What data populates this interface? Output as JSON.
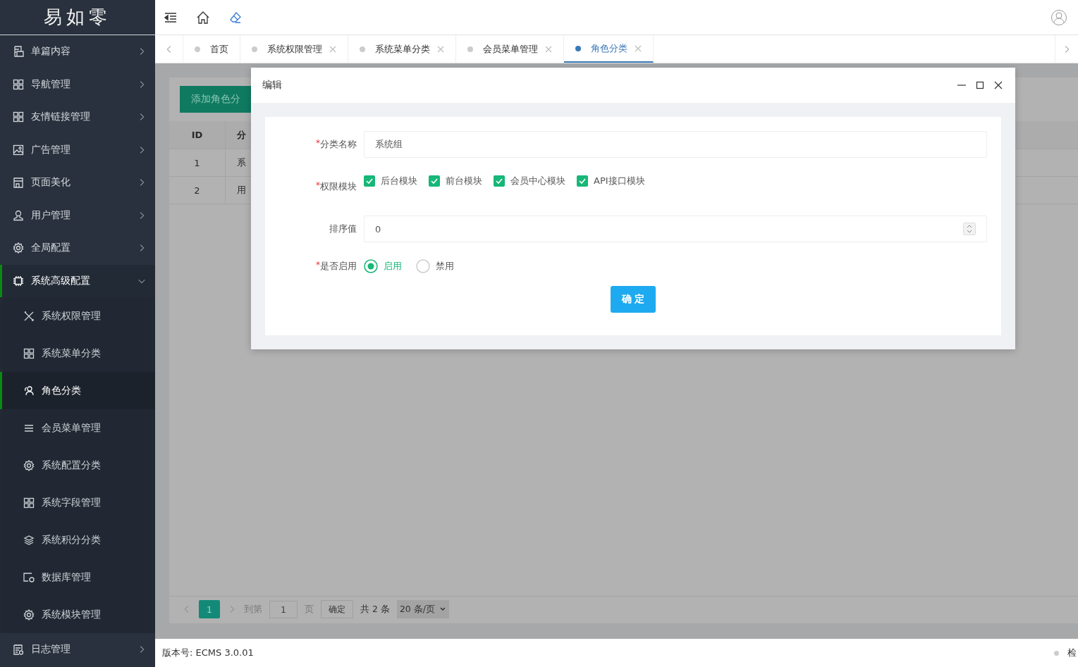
{
  "logo": {
    "text": "易如零"
  },
  "sidebar": {
    "items": [
      {
        "label": "单篇内容",
        "expanded": false,
        "selected": false
      },
      {
        "label": "导航管理",
        "expanded": false,
        "selected": false
      },
      {
        "label": "友情链接管理",
        "expanded": false,
        "selected": false
      },
      {
        "label": "广告管理",
        "expanded": false,
        "selected": false
      },
      {
        "label": "页面美化",
        "expanded": false,
        "selected": false
      },
      {
        "label": "用户管理",
        "expanded": false,
        "selected": false
      },
      {
        "label": "全局配置",
        "expanded": false,
        "selected": false
      },
      {
        "label": "系统高级配置",
        "expanded": true,
        "selected": true,
        "children": [
          {
            "label": "系统权限管理",
            "selected": false
          },
          {
            "label": "系统菜单分类",
            "selected": false
          },
          {
            "label": "角色分类",
            "selected": true
          },
          {
            "label": "会员菜单管理",
            "selected": false
          },
          {
            "label": "系统配置分类",
            "selected": false
          },
          {
            "label": "系统字段管理",
            "selected": false
          },
          {
            "label": "系统积分分类",
            "selected": false
          },
          {
            "label": "数据库管理",
            "selected": false
          },
          {
            "label": "系统模块管理",
            "selected": false
          }
        ]
      },
      {
        "label": "日志管理",
        "expanded": false,
        "selected": false
      }
    ]
  },
  "tabs": [
    {
      "label": "首页",
      "selected": false,
      "closable": false
    },
    {
      "label": "系统权限管理",
      "selected": false,
      "closable": true
    },
    {
      "label": "系统菜单分类",
      "selected": false,
      "closable": true
    },
    {
      "label": "会员菜单管理",
      "selected": false,
      "closable": true
    },
    {
      "label": "角色分类",
      "selected": true,
      "closable": true
    }
  ],
  "page": {
    "add_button": "添加角色分",
    "table": {
      "columns": [
        "ID",
        "分"
      ],
      "rows": [
        [
          "1",
          "系"
        ],
        [
          "2",
          "用"
        ]
      ]
    },
    "pagination": {
      "current": "1",
      "goto_label": "到第",
      "page_input": "1",
      "page_unit": "页",
      "confirm": "确定",
      "total": "共 2 条",
      "page_size": "20 条/页"
    }
  },
  "dialog": {
    "title": "编辑",
    "fields": [
      {
        "kind": "text",
        "label": "分类名称",
        "required_mark": "*",
        "value": "系统组"
      },
      {
        "kind": "checkboxes",
        "label": "权限模块",
        "required_mark": "*",
        "options": [
          {
            "label": "后台模块",
            "checked": true
          },
          {
            "label": "前台模块",
            "checked": true
          },
          {
            "label": "会员中心模块",
            "checked": true
          },
          {
            "label": "API接口模块",
            "checked": true
          }
        ]
      },
      {
        "kind": "number",
        "label": "排序值",
        "value": "0"
      },
      {
        "kind": "radio",
        "label": "是否启用",
        "required_mark": "*",
        "options": [
          {
            "label": "启用",
            "selected": true
          },
          {
            "label": "禁用",
            "selected": false
          }
        ]
      }
    ],
    "submit": "确 定"
  },
  "status_bar": {
    "version": "版本号: ECMS 3.0.01",
    "right_text": "检"
  }
}
